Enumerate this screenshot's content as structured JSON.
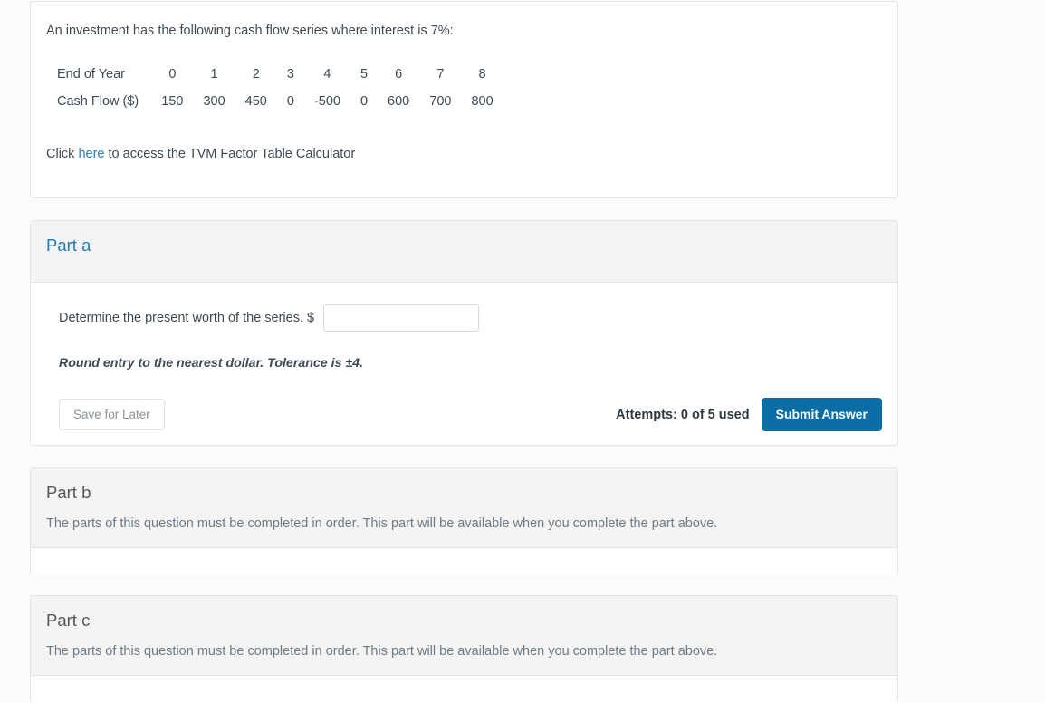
{
  "stem": {
    "intro": "An investment has the following cash flow series where interest is 7%:",
    "table": {
      "row_labels": [
        "End of Year",
        "Cash Flow ($)"
      ],
      "years": [
        "0",
        "1",
        "2",
        "3",
        "4",
        "5",
        "6",
        "7",
        "8"
      ],
      "cash_flows": [
        "150",
        "300",
        "450",
        "0",
        "-500",
        "0",
        "600",
        "700",
        "800"
      ]
    },
    "tvm_prefix": "Click ",
    "tvm_link": "here",
    "tvm_suffix": " to access the TVM Factor Table Calculator"
  },
  "part_a": {
    "title": "Part a",
    "question_label": "Determine the present worth of the series. $",
    "answer_value": "",
    "answer_placeholder": "",
    "tolerance_note": "Round entry to the nearest dollar. Tolerance is ±4.",
    "save_label": "Save for Later",
    "attempts_text": "Attempts: 0 of 5 used",
    "submit_label": "Submit Answer"
  },
  "part_b": {
    "title": "Part b",
    "locked_message": "The parts of this question must be completed in order. This part will be available when you complete the part above."
  },
  "part_c": {
    "title": "Part c",
    "locked_message": "The parts of this question must be completed in order. This part will be available when you complete the part above."
  },
  "colors": {
    "accent_link": "#2a7fb8",
    "part_active": "#2179b5",
    "submit_button": "#0a6ea4",
    "card_border": "#e2e4e6",
    "header_bg": "#f4f4f5",
    "page_bg": "#fbfbfb"
  }
}
